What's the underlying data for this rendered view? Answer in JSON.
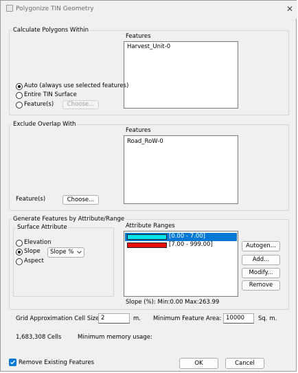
{
  "window": {
    "title": "Polygonize TIN Geometry",
    "close_glyph": "✕"
  },
  "calc": {
    "legend": "Calculate Polygons Within",
    "features_label": "Features",
    "features": [
      "Harvest_Unit-0"
    ],
    "options": [
      "Auto (always use selected features)",
      "Entire TIN Surface",
      "Feature(s)"
    ],
    "selected_option": "Auto (always use selected features)",
    "choose_label": "Choose..."
  },
  "exclude": {
    "legend": "Exclude Overlap With",
    "features_label": "Features",
    "features": [
      "Road_RoW-0"
    ],
    "features_field_label": "Feature(s)",
    "choose_label": "Choose..."
  },
  "generate": {
    "legend": "Generate Features by Attribute/Range",
    "surface_attr_legend": "Surface Attribute",
    "options": [
      "Elevation",
      "Slope",
      "Aspect"
    ],
    "selected_option": "Slope",
    "slope_unit": "Slope %",
    "ranges_label": "Attribute Ranges",
    "ranges": [
      {
        "label": "[0.00 - 7.00]",
        "color": "#00e5ee",
        "selected": true
      },
      {
        "label": "[7.00 - 999.00]",
        "color": "#e81010",
        "selected": false
      }
    ],
    "buttons": {
      "autogen": "Autogen...",
      "add": "Add...",
      "modify": "Modify...",
      "remove": "Remove"
    },
    "stats": "Slope (%): Min:0.00   Max:263.99"
  },
  "grid": {
    "cell_size_label": "Grid Approximation Cell Size:",
    "cell_size_value": "2",
    "cell_size_unit": "m.",
    "min_area_label": "Minimum Feature Area:",
    "min_area_value": "10000",
    "min_area_unit": "Sq. m.",
    "cells_text": "1,683,308 Cells",
    "memory_text": "Minimum memory usage:"
  },
  "footer": {
    "remove_existing_label": "Remove Existing Features",
    "remove_existing_checked": true,
    "ok_label": "OK",
    "cancel_label": "Cancel"
  },
  "colors": {
    "accent": "#0078d4",
    "selection": "#0078d4"
  }
}
